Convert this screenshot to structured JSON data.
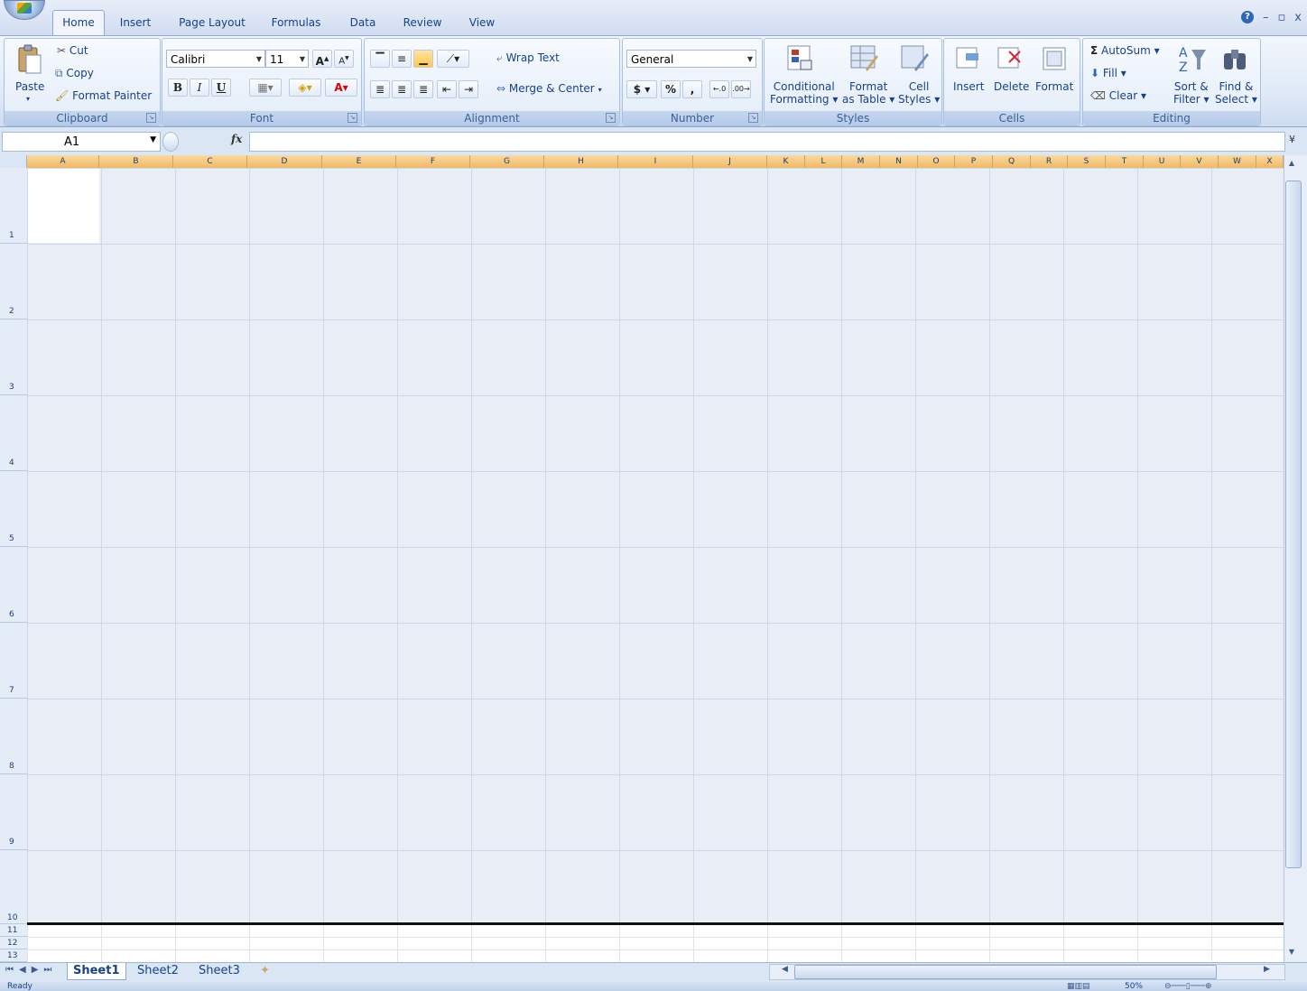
{
  "tabs": [
    "Home",
    "Insert",
    "Page Layout",
    "Formulas",
    "Data",
    "Review",
    "View"
  ],
  "active_tab": "Home",
  "clipboard": {
    "label": "Clipboard",
    "paste": "Paste",
    "cut": "Cut",
    "copy": "Copy",
    "format_painter": "Format Painter"
  },
  "font": {
    "label": "Font",
    "name": "Calibri",
    "size": "11",
    "bold": "B",
    "italic": "I",
    "underline": "U"
  },
  "alignment": {
    "label": "Alignment",
    "wrap_text": "Wrap Text",
    "merge_center": "Merge & Center"
  },
  "number": {
    "label": "Number",
    "format": "General",
    "currency": "$",
    "percent": "%",
    "comma": ","
  },
  "styles": {
    "label": "Styles",
    "conditional_1": "Conditional",
    "conditional_2": "Formatting",
    "format_table_1": "Format",
    "format_table_2": "as Table",
    "cell_styles_1": "Cell",
    "cell_styles_2": "Styles"
  },
  "cells": {
    "label": "Cells",
    "insert": "Insert",
    "delete": "Delete",
    "format": "Format"
  },
  "editing": {
    "label": "Editing",
    "autosum": "AutoSum",
    "fill": "Fill",
    "clear": "Clear",
    "sort_1": "Sort &",
    "sort_2": "Filter",
    "find_1": "Find &",
    "find_2": "Select"
  },
  "formula_bar": {
    "name_box": "A1",
    "fx": "fx",
    "value": ""
  },
  "columns": [
    "A",
    "B",
    "C",
    "D",
    "E",
    "F",
    "G",
    "H",
    "I",
    "J",
    "K",
    "L",
    "M",
    "N",
    "O",
    "P",
    "Q",
    "R",
    "S",
    "T",
    "U",
    "V",
    "W",
    "X"
  ],
  "rows": [
    "1",
    "2",
    "3",
    "4",
    "5",
    "6",
    "7",
    "8",
    "9",
    "10",
    "11",
    "12",
    "13"
  ],
  "sheets": [
    "Sheet1",
    "Sheet2",
    "Sheet3"
  ],
  "active_sheet": "Sheet1",
  "status": {
    "ready": "Ready",
    "zoom": "50%"
  }
}
